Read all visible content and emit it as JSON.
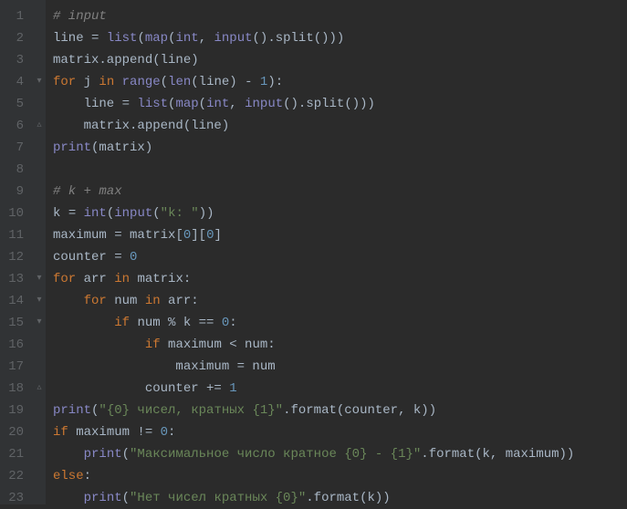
{
  "gutter": {
    "start": 1,
    "end": 23
  },
  "fold": [
    "",
    "",
    "",
    "▾",
    "",
    "▵",
    "",
    "",
    "",
    "",
    "",
    "",
    "▾",
    "▾",
    "▾",
    "",
    "",
    "▵",
    "",
    "",
    "",
    "",
    ""
  ],
  "code": {
    "lines": [
      [
        {
          "t": "# input",
          "c": "comment"
        }
      ],
      [
        {
          "t": "line ",
          "c": "ident"
        },
        {
          "t": "= ",
          "c": "op"
        },
        {
          "t": "list",
          "c": "builtin"
        },
        {
          "t": "(",
          "c": "op"
        },
        {
          "t": "map",
          "c": "builtin"
        },
        {
          "t": "(",
          "c": "op"
        },
        {
          "t": "int",
          "c": "builtin"
        },
        {
          "t": ", ",
          "c": "op"
        },
        {
          "t": "input",
          "c": "builtin"
        },
        {
          "t": "().split()))",
          "c": "op"
        }
      ],
      [
        {
          "t": "matrix.append(line)",
          "c": "ident"
        }
      ],
      [
        {
          "t": "for ",
          "c": "keyword"
        },
        {
          "t": "j ",
          "c": "ident"
        },
        {
          "t": "in ",
          "c": "keyword"
        },
        {
          "t": "range",
          "c": "builtin"
        },
        {
          "t": "(",
          "c": "op"
        },
        {
          "t": "len",
          "c": "builtin"
        },
        {
          "t": "(line) - ",
          "c": "op"
        },
        {
          "t": "1",
          "c": "number"
        },
        {
          "t": "):",
          "c": "op"
        }
      ],
      [
        {
          "t": "    line ",
          "c": "ident"
        },
        {
          "t": "= ",
          "c": "op"
        },
        {
          "t": "list",
          "c": "builtin"
        },
        {
          "t": "(",
          "c": "op"
        },
        {
          "t": "map",
          "c": "builtin"
        },
        {
          "t": "(",
          "c": "op"
        },
        {
          "t": "int",
          "c": "builtin"
        },
        {
          "t": ", ",
          "c": "op"
        },
        {
          "t": "input",
          "c": "builtin"
        },
        {
          "t": "().split()))",
          "c": "op"
        }
      ],
      [
        {
          "t": "    matrix.append(line)",
          "c": "ident"
        }
      ],
      [
        {
          "t": "print",
          "c": "builtin"
        },
        {
          "t": "(matrix)",
          "c": "op"
        }
      ],
      [
        {
          "t": "",
          "c": "ident"
        }
      ],
      [
        {
          "t": "# k + max",
          "c": "comment"
        }
      ],
      [
        {
          "t": "k ",
          "c": "ident"
        },
        {
          "t": "= ",
          "c": "op"
        },
        {
          "t": "int",
          "c": "builtin"
        },
        {
          "t": "(",
          "c": "op"
        },
        {
          "t": "input",
          "c": "builtin"
        },
        {
          "t": "(",
          "c": "op"
        },
        {
          "t": "\"k: \"",
          "c": "string"
        },
        {
          "t": "))",
          "c": "op"
        }
      ],
      [
        {
          "t": "maximum ",
          "c": "ident"
        },
        {
          "t": "= ",
          "c": "op"
        },
        {
          "t": "matrix[",
          "c": "ident"
        },
        {
          "t": "0",
          "c": "number"
        },
        {
          "t": "][",
          "c": "op"
        },
        {
          "t": "0",
          "c": "number"
        },
        {
          "t": "]",
          "c": "op"
        }
      ],
      [
        {
          "t": "counter ",
          "c": "ident"
        },
        {
          "t": "= ",
          "c": "op"
        },
        {
          "t": "0",
          "c": "number"
        }
      ],
      [
        {
          "t": "for ",
          "c": "keyword"
        },
        {
          "t": "arr ",
          "c": "ident"
        },
        {
          "t": "in ",
          "c": "keyword"
        },
        {
          "t": "matrix:",
          "c": "ident"
        }
      ],
      [
        {
          "t": "    ",
          "c": "ident"
        },
        {
          "t": "for ",
          "c": "keyword"
        },
        {
          "t": "num ",
          "c": "ident"
        },
        {
          "t": "in ",
          "c": "keyword"
        },
        {
          "t": "arr:",
          "c": "ident"
        }
      ],
      [
        {
          "t": "        ",
          "c": "ident"
        },
        {
          "t": "if ",
          "c": "keyword"
        },
        {
          "t": "num % k == ",
          "c": "ident"
        },
        {
          "t": "0",
          "c": "number"
        },
        {
          "t": ":",
          "c": "op"
        }
      ],
      [
        {
          "t": "            ",
          "c": "ident"
        },
        {
          "t": "if ",
          "c": "keyword"
        },
        {
          "t": "maximum < num:",
          "c": "ident"
        }
      ],
      [
        {
          "t": "                maximum = num",
          "c": "ident"
        }
      ],
      [
        {
          "t": "            counter += ",
          "c": "ident"
        },
        {
          "t": "1",
          "c": "number"
        }
      ],
      [
        {
          "t": "print",
          "c": "builtin"
        },
        {
          "t": "(",
          "c": "op"
        },
        {
          "t": "\"{0} чисел, кратных {1}\"",
          "c": "string"
        },
        {
          "t": ".format(counter, k))",
          "c": "ident"
        }
      ],
      [
        {
          "t": "if ",
          "c": "keyword"
        },
        {
          "t": "maximum != ",
          "c": "ident"
        },
        {
          "t": "0",
          "c": "number"
        },
        {
          "t": ":",
          "c": "op"
        }
      ],
      [
        {
          "t": "    ",
          "c": "ident"
        },
        {
          "t": "print",
          "c": "builtin"
        },
        {
          "t": "(",
          "c": "op"
        },
        {
          "t": "\"Максимальное число кратное {0} - {1}\"",
          "c": "string"
        },
        {
          "t": ".format(k, maximum))",
          "c": "ident"
        }
      ],
      [
        {
          "t": "else",
          "c": "keyword"
        },
        {
          "t": ":",
          "c": "op"
        }
      ],
      [
        {
          "t": "    ",
          "c": "ident"
        },
        {
          "t": "print",
          "c": "builtin"
        },
        {
          "t": "(",
          "c": "op"
        },
        {
          "t": "\"Нет чисел кратных {0}\"",
          "c": "string"
        },
        {
          "t": ".format(k))",
          "c": "ident"
        }
      ]
    ]
  }
}
